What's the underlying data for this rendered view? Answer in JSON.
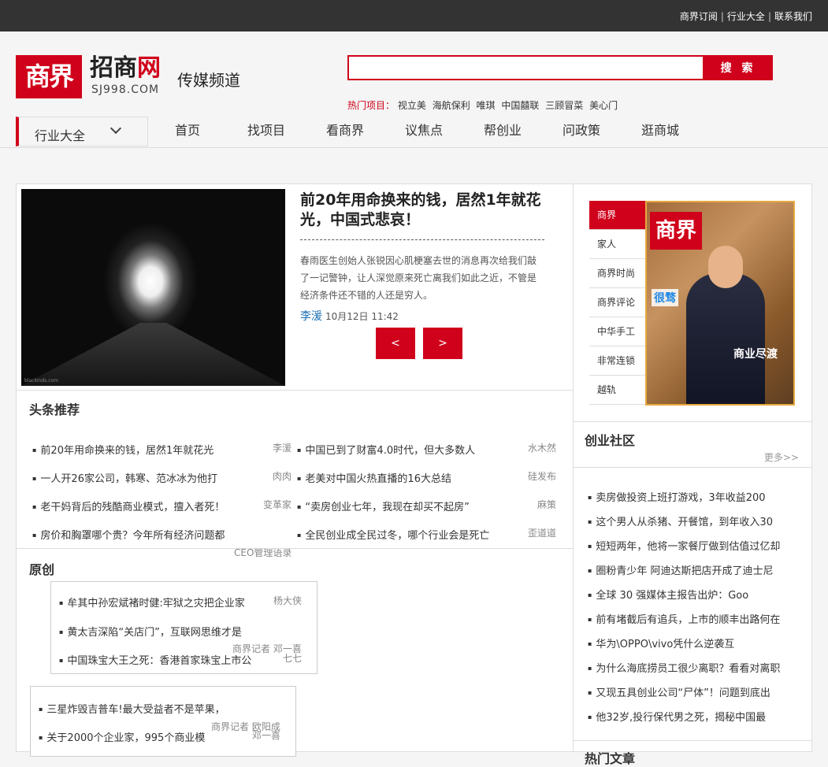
{
  "topbar": {
    "links": [
      "商界订阅",
      "行业大全",
      "联系我们"
    ]
  },
  "header": {
    "logo_mark": "商界",
    "logo_name_black": "招商",
    "logo_name_red": "网",
    "logo_domain": "SJ998.COM",
    "channel": "传媒频道",
    "search_placeholder": "",
    "search_button": "搜 索",
    "hot_label": "热门项目：",
    "hot_items": [
      "视立美",
      "海航保利",
      "唯琪",
      "中国囍联",
      "三顾冒菜",
      "美心门"
    ]
  },
  "category": {
    "label": "行业大全"
  },
  "nav": [
    "首页",
    "找项目",
    "看商界",
    "议焦点",
    "帮创业",
    "问政策",
    "逛商城"
  ],
  "hero": {
    "image_credit": "blackinds.com",
    "title": "前20年用命换来的钱，居然1年就花光，中国式悲哀！",
    "desc": "春雨医生创始人张锐因心肌梗塞去世的消息再次给我们敲了一记警钟，让人深觉原来死亡离我们如此之近，不管是经济条件还不错的人还是穷人。",
    "author": "李湲",
    "date": "10月12日 11:42",
    "prev": "<",
    "next": ">"
  },
  "headlines": {
    "title": "头条推荐",
    "left": [
      {
        "text": "前20年用命换来的钱，居然1年就花光",
        "author": "李湲"
      },
      {
        "text": "一人开26家公司，韩寒、范冰冰为他打",
        "author": "肉肉"
      },
      {
        "text": "老干妈背后的残酷商业模式，擅入者死！",
        "author": "变革家"
      },
      {
        "text": "房价和胸罩哪个贵？今年所有经济问题都",
        "author": "CEO管理语录"
      }
    ],
    "right": [
      {
        "text": "中国已到了财富4.0时代，但大多数人",
        "author": "水木然"
      },
      {
        "text": "老美对中国火热直播的16大总结",
        "author": "硅发布"
      },
      {
        "text": "“卖房创业七年，我现在却买不起房”",
        "author": "麻策"
      },
      {
        "text": "全民创业成全民过冬，哪个行业会是死亡",
        "author": "歪道道"
      }
    ]
  },
  "original": {
    "title": "原创",
    "box1": [
      {
        "text": "牟其中孙宏斌褚时健:牢狱之灾把企业家",
        "author": "杨大侠"
      },
      {
        "text": "黄太吉深陷“关店门”，互联网思维才是",
        "author": "商界记者 邓一喜"
      },
      {
        "text": "中国珠宝大王之死：香港首家珠宝上市公",
        "author": "七七"
      }
    ],
    "box2": [
      {
        "text": "三星炸毁吉普车!最大受益者不是苹果，",
        "author": "商界记者 欧阳成"
      },
      {
        "text": "关于2000个企业家，995个商业模",
        "author": "邓一喜"
      }
    ]
  },
  "sidebar": {
    "tabs": [
      "商界",
      "家人",
      "商界时尚",
      "商界评论",
      "中华手工",
      "非常连锁",
      "越轨"
    ],
    "magazine": {
      "logo": "商界",
      "blue_text": "很骛",
      "cover_text": "商业尽渡"
    },
    "community_title": "创业社区",
    "more": "更多>>",
    "community": [
      "卖房做投资上班打游戏，3年收益200",
      "这个男人从杀猪、开餐馆，到年收入30",
      "短短两年，他将一家餐厅做到估值过亿却",
      "圈粉青少年 阿迪达斯把店开成了迪士尼",
      "全球 30 强媒体主报告出炉：Goo",
      "前有堵截后有追兵，上市的顺丰出路何在",
      "华为\\OPPO\\vivo凭什么逆袭互",
      "为什么海底捞员工很少离职？看看对离职",
      "又现五具创业公司“尸体”！问题到底出",
      "他32岁,投行保代男之死，揭秘中国最"
    ],
    "next_title": "热门文章"
  },
  "colors": {
    "accent": "#d0021b",
    "topbar": "#333333",
    "link": "#1a6eb5"
  }
}
